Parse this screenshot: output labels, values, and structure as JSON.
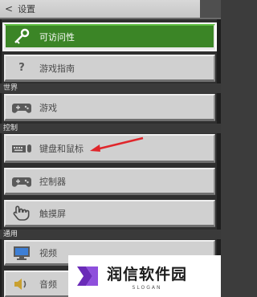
{
  "header": {
    "back_glyph": "<",
    "title": "设置"
  },
  "sections": {
    "world": "世界",
    "controls": "控制",
    "general": "通用"
  },
  "items": [
    {
      "label": "可访问性",
      "icon": "key-icon",
      "selected": true
    },
    {
      "label": "游戏指南",
      "icon": "question-icon",
      "selected": false
    },
    {
      "label": "游戏",
      "icon": "gamepad-icon",
      "selected": false
    },
    {
      "label": "键盘和鼠标",
      "icon": "keyboard-mouse-icon",
      "selected": false
    },
    {
      "label": "控制器",
      "icon": "controller-icon",
      "selected": false
    },
    {
      "label": "触摸屏",
      "icon": "touch-hand-icon",
      "selected": false
    },
    {
      "label": "视频",
      "icon": "monitor-icon",
      "selected": false
    },
    {
      "label": "音频",
      "icon": "speaker-icon",
      "selected": false
    }
  ],
  "question_glyph": "?",
  "watermark": {
    "main": "润信软件园",
    "sub": "SLOGAN"
  },
  "colors": {
    "selected_green": "#3b8526",
    "button_gray": "#d0d0d0",
    "annotation_arrow": "#e0262b",
    "watermark_purple": "#6a2bb8"
  }
}
